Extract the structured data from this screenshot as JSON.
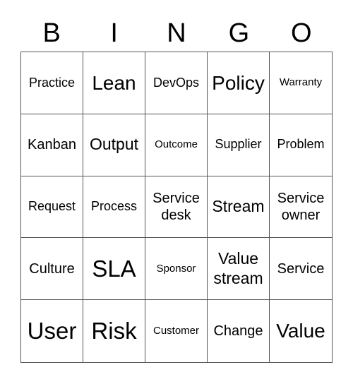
{
  "header": [
    "B",
    "I",
    "N",
    "G",
    "O"
  ],
  "cells": [
    {
      "text": "Practice",
      "size": "s-sm"
    },
    {
      "text": "Lean",
      "size": "s-xl"
    },
    {
      "text": "DevOps",
      "size": "s-sm"
    },
    {
      "text": "Policy",
      "size": "s-xl"
    },
    {
      "text": "Warranty",
      "size": "s-xs"
    },
    {
      "text": "Kanban",
      "size": "s-md"
    },
    {
      "text": "Output",
      "size": "s-lg"
    },
    {
      "text": "Outcome",
      "size": "s-xs"
    },
    {
      "text": "Supplier",
      "size": "s-sm"
    },
    {
      "text": "Problem",
      "size": "s-sm"
    },
    {
      "text": "Request",
      "size": "s-sm"
    },
    {
      "text": "Process",
      "size": "s-sm"
    },
    {
      "text": "Service desk",
      "size": "s-md"
    },
    {
      "text": "Stream",
      "size": "s-lg"
    },
    {
      "text": "Service owner",
      "size": "s-md"
    },
    {
      "text": "Culture",
      "size": "s-md"
    },
    {
      "text": "SLA",
      "size": "s-xxl"
    },
    {
      "text": "Sponsor",
      "size": "s-xs"
    },
    {
      "text": "Value stream",
      "size": "s-lg"
    },
    {
      "text": "Service",
      "size": "s-md"
    },
    {
      "text": "User",
      "size": "s-xxl"
    },
    {
      "text": "Risk",
      "size": "s-xxl"
    },
    {
      "text": "Customer",
      "size": "s-xs"
    },
    {
      "text": "Change",
      "size": "s-md"
    },
    {
      "text": "Value",
      "size": "s-xl"
    }
  ]
}
